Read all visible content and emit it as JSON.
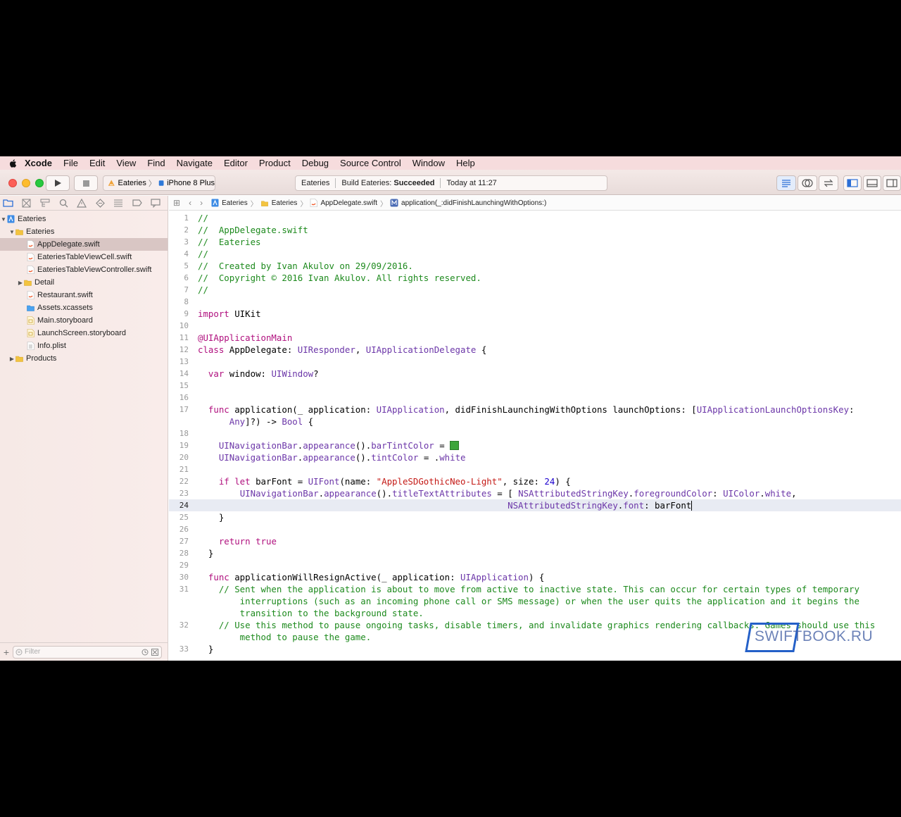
{
  "menubar": {
    "app_name": "Xcode",
    "items": [
      "File",
      "Edit",
      "View",
      "Find",
      "Navigate",
      "Editor",
      "Product",
      "Debug",
      "Source Control",
      "Window",
      "Help"
    ]
  },
  "toolbar": {
    "scheme": "Eateries",
    "device": "iPhone 8 Plus",
    "status_project": "Eateries",
    "status_build_prefix": "Build Eateries:",
    "status_build_result": "Succeeded",
    "status_time": "Today at 11:27"
  },
  "navigator": {
    "tree": [
      {
        "label": "Eateries",
        "icon": "project-icon"
      },
      {
        "label": "Eateries",
        "icon": "folder-icon"
      },
      {
        "label": "AppDelegate.swift",
        "icon": "swift-file-icon"
      },
      {
        "label": "EateriesTableViewCell.swift",
        "icon": "swift-file-icon"
      },
      {
        "label": "EateriesTableViewController.swift",
        "icon": "swift-file-icon"
      },
      {
        "label": "Detail",
        "icon": "folder-icon"
      },
      {
        "label": "Restaurant.swift",
        "icon": "swift-file-icon"
      },
      {
        "label": "Assets.xcassets",
        "icon": "assets-icon"
      },
      {
        "label": "Main.storyboard",
        "icon": "storyboard-icon"
      },
      {
        "label": "LaunchScreen.storyboard",
        "icon": "storyboard-icon"
      },
      {
        "label": "Info.plist",
        "icon": "plist-icon"
      },
      {
        "label": "Products",
        "icon": "folder-icon"
      }
    ],
    "filter_placeholder": "Filter"
  },
  "jumpbar": {
    "crumbs": [
      "Eateries",
      "Eateries",
      "AppDelegate.swift",
      "application(_:didFinishLaunchingWithOptions:)"
    ]
  },
  "editor": {
    "current_line": "24",
    "line_numbers": [
      "1",
      "2",
      "3",
      "4",
      "5",
      "6",
      "7",
      "8",
      "9",
      "10",
      "11",
      "12",
      "13",
      "14",
      "15",
      "16",
      "17",
      "18",
      "19",
      "20",
      "21",
      "22",
      "23",
      "24",
      "25",
      "26",
      "27",
      "28",
      "29",
      "30",
      "31",
      "32",
      "33"
    ],
    "lines": [
      [
        {
          "t": "//",
          "c": "comment"
        }
      ],
      [
        {
          "t": "//  AppDelegate.swift",
          "c": "comment"
        }
      ],
      [
        {
          "t": "//  Eateries",
          "c": "comment"
        }
      ],
      [
        {
          "t": "//",
          "c": "comment"
        }
      ],
      [
        {
          "t": "//  Created by Ivan Akulov on 29/09/2016.",
          "c": "comment"
        }
      ],
      [
        {
          "t": "//  Copyright © 2016 Ivan Akulov. All rights reserved.",
          "c": "comment"
        }
      ],
      [
        {
          "t": "//",
          "c": "comment"
        }
      ],
      [],
      [
        {
          "t": "import",
          "c": "kw"
        },
        {
          "t": " UIKit",
          "c": "plain"
        }
      ],
      [],
      [
        {
          "t": "@UIApplicationMain",
          "c": "kw"
        }
      ],
      [
        {
          "t": "class",
          "c": "kw"
        },
        {
          "t": " AppDelegate: ",
          "c": "plain"
        },
        {
          "t": "UIResponder",
          "c": "type"
        },
        {
          "t": ", ",
          "c": "plain"
        },
        {
          "t": "UIApplicationDelegate",
          "c": "type"
        },
        {
          "t": " {",
          "c": "plain"
        }
      ],
      [],
      [
        {
          "t": "  ",
          "c": "plain"
        },
        {
          "t": "var",
          "c": "kw"
        },
        {
          "t": " window: ",
          "c": "plain"
        },
        {
          "t": "UIWindow",
          "c": "type"
        },
        {
          "t": "?",
          "c": "plain"
        }
      ],
      [],
      [],
      [
        {
          "t": "  ",
          "c": "plain"
        },
        {
          "t": "func",
          "c": "kw"
        },
        {
          "t": " application(_ application: ",
          "c": "plain"
        },
        {
          "t": "UIApplication",
          "c": "type"
        },
        {
          "t": ", didFinishLaunchingWithOptions launchOptions: [",
          "c": "plain"
        },
        {
          "t": "UIApplicationLaunchOptionsKey",
          "c": "type"
        },
        {
          "t": ":",
          "c": "plain"
        }
      ],
      [
        {
          "t": "      ",
          "c": "plain"
        },
        {
          "t": "Any",
          "c": "type"
        },
        {
          "t": "]?) -> ",
          "c": "plain"
        },
        {
          "t": "Bool",
          "c": "type"
        },
        {
          "t": " {",
          "c": "plain"
        }
      ],
      [],
      [
        {
          "t": "    ",
          "c": "plain"
        },
        {
          "t": "UINavigationBar",
          "c": "type"
        },
        {
          "t": ".",
          "c": "plain"
        },
        {
          "t": "appearance",
          "c": "type"
        },
        {
          "t": "().",
          "c": "plain"
        },
        {
          "t": "barTintColor",
          "c": "type"
        },
        {
          "t": " = ",
          "c": "plain"
        },
        {
          "t": "",
          "c": "swatch"
        }
      ],
      [
        {
          "t": "    ",
          "c": "plain"
        },
        {
          "t": "UINavigationBar",
          "c": "type"
        },
        {
          "t": ".",
          "c": "plain"
        },
        {
          "t": "appearance",
          "c": "type"
        },
        {
          "t": "().",
          "c": "plain"
        },
        {
          "t": "tintColor",
          "c": "type"
        },
        {
          "t": " = .",
          "c": "plain"
        },
        {
          "t": "white",
          "c": "type"
        }
      ],
      [],
      [
        {
          "t": "    ",
          "c": "plain"
        },
        {
          "t": "if let",
          "c": "kw"
        },
        {
          "t": " barFont = ",
          "c": "plain"
        },
        {
          "t": "UIFont",
          "c": "type"
        },
        {
          "t": "(name: ",
          "c": "plain"
        },
        {
          "t": "\"AppleSDGothicNeo-Light\"",
          "c": "str"
        },
        {
          "t": ", size: ",
          "c": "plain"
        },
        {
          "t": "24",
          "c": "num"
        },
        {
          "t": ") {",
          "c": "plain"
        }
      ],
      [
        {
          "t": "        ",
          "c": "plain"
        },
        {
          "t": "UINavigationBar",
          "c": "type"
        },
        {
          "t": ".",
          "c": "plain"
        },
        {
          "t": "appearance",
          "c": "type"
        },
        {
          "t": "().",
          "c": "plain"
        },
        {
          "t": "titleTextAttributes",
          "c": "type"
        },
        {
          "t": " = [ ",
          "c": "plain"
        },
        {
          "t": "NSAttributedStringKey",
          "c": "type"
        },
        {
          "t": ".",
          "c": "plain"
        },
        {
          "t": "foregroundColor",
          "c": "type"
        },
        {
          "t": ": ",
          "c": "plain"
        },
        {
          "t": "UIColor",
          "c": "type"
        },
        {
          "t": ".",
          "c": "plain"
        },
        {
          "t": "white",
          "c": "type"
        },
        {
          "t": ",",
          "c": "plain"
        }
      ],
      [
        {
          "t": "                                                           ",
          "c": "plain"
        },
        {
          "t": "NSAttributedStringKey",
          "c": "type"
        },
        {
          "t": ".",
          "c": "plain"
        },
        {
          "t": "font",
          "c": "type"
        },
        {
          "t": ": barFont",
          "c": "plain"
        },
        {
          "t": "",
          "c": "caret"
        }
      ],
      [
        {
          "t": "    }",
          "c": "plain"
        }
      ],
      [],
      [
        {
          "t": "    ",
          "c": "plain"
        },
        {
          "t": "return",
          "c": "kw"
        },
        {
          "t": " ",
          "c": "plain"
        },
        {
          "t": "true",
          "c": "kw"
        }
      ],
      [
        {
          "t": "  }",
          "c": "plain"
        }
      ],
      [],
      [
        {
          "t": "  ",
          "c": "plain"
        },
        {
          "t": "func",
          "c": "kw"
        },
        {
          "t": " applicationWillResignActive(_ application: ",
          "c": "plain"
        },
        {
          "t": "UIApplication",
          "c": "type"
        },
        {
          "t": ") {",
          "c": "plain"
        }
      ],
      [
        {
          "t": "    // Sent when the application is about to move from active to inactive state. This can occur for certain types of temporary",
          "c": "comment"
        }
      ],
      [
        {
          "t": "        interruptions (such as an incoming phone call or SMS message) or when the user quits the application and it begins the",
          "c": "comment"
        }
      ],
      [
        {
          "t": "        transition to the background state.",
          "c": "comment"
        }
      ],
      [
        {
          "t": "    // Use this method to pause ongoing tasks, disable timers, and invalidate graphics rendering callbacks. Games should use this",
          "c": "comment"
        }
      ],
      [
        {
          "t": "        method to pause the game.",
          "c": "comment"
        }
      ],
      [
        {
          "t": "  }",
          "c": "plain"
        }
      ]
    ],
    "line_label_index": [
      0,
      1,
      2,
      3,
      4,
      5,
      6,
      7,
      8,
      9,
      10,
      11,
      12,
      13,
      14,
      15,
      16,
      -1,
      17,
      18,
      19,
      20,
      21,
      22,
      23,
      24,
      25,
      26,
      27,
      28,
      29,
      30,
      -1,
      -1,
      31,
      -1,
      32
    ]
  },
  "watermark": {
    "text": "SWIFTBOOK.RU"
  }
}
